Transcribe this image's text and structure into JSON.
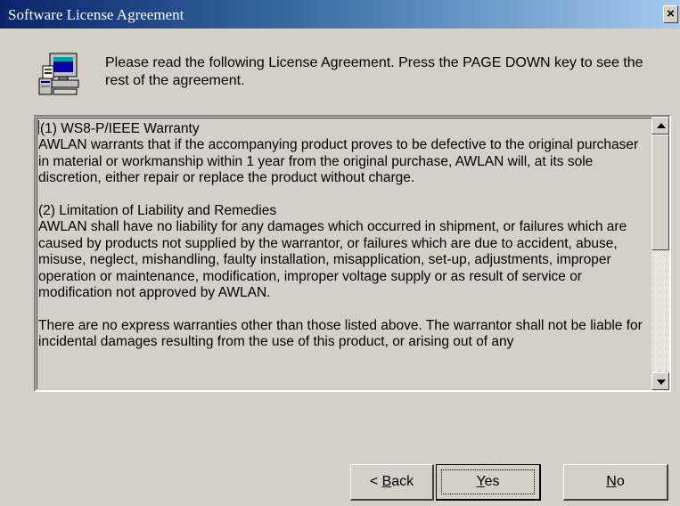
{
  "window": {
    "title": "Software License Agreement",
    "close_label": "×"
  },
  "header": {
    "icon": "computer-setup-icon",
    "instruction": "Please read the following License Agreement.  Press the PAGE DOWN key to see the rest of the agreement."
  },
  "license": {
    "paragraphs": [
      "(1) WS8-P/IEEE Warranty\nAWLAN warrants that if the accompanying product proves to be defective to the original purchaser in material or workmanship within 1 year from the original purchase, AWLAN will, at its sole discretion, either repair or replace the product without charge.",
      "(2) Limitation of Liability and Remedies\nAWLAN shall have no liability for any damages which occurred in shipment, or failures which are caused by products not supplied by the warrantor, or failures which are due to accident, abuse, misuse, neglect, mishandling, faulty installation, misapplication, set-up, adjustments, improper operation or maintenance, modification, improper voltage supply or as result of service or modification not approved by AWLAN.",
      "There are no express warranties other than those listed above. The warrantor shall not be liable for incidental damages resulting from the use of this product, or arising out of any"
    ]
  },
  "buttons": {
    "back": {
      "prefix": "< ",
      "mnemonic": "B",
      "rest": "ack"
    },
    "yes": {
      "mnemonic": "Y",
      "rest": "es"
    },
    "no": {
      "mnemonic": "N",
      "rest": "o"
    }
  },
  "colors": {
    "dialog_face": "#d4d0c8",
    "titlebar_start": "#0a246a",
    "titlebar_end": "#a6caf0"
  }
}
